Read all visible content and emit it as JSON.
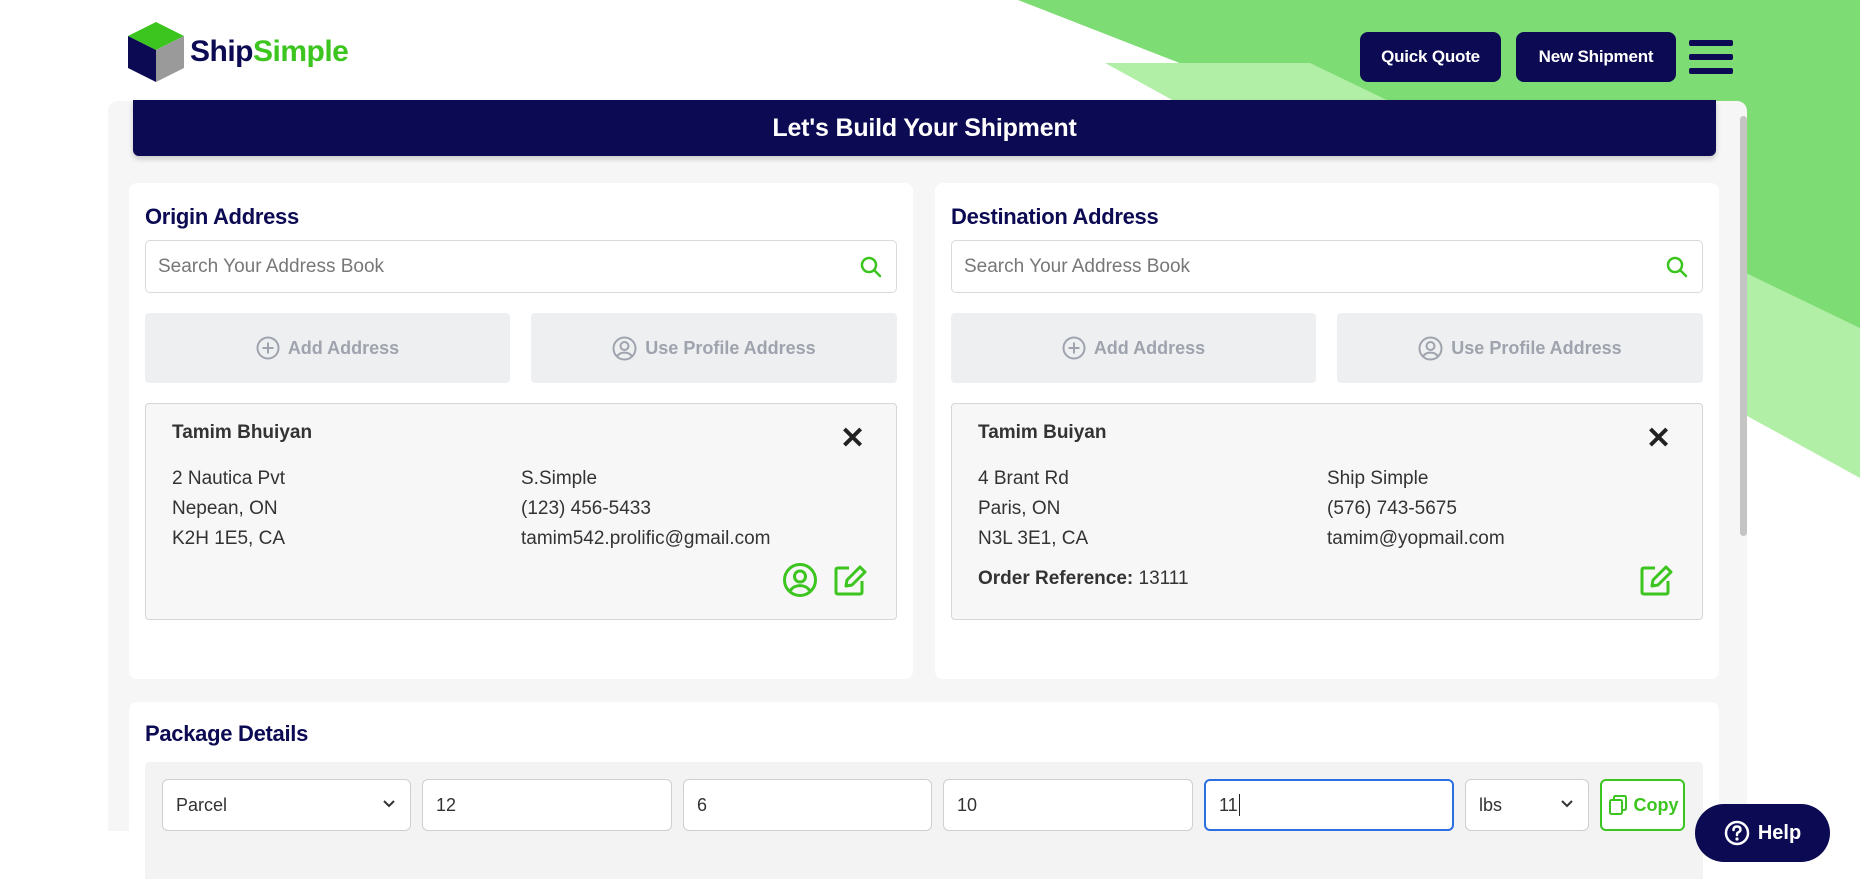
{
  "brand": {
    "name_part1": "Ship",
    "name_part2": "Simple"
  },
  "header": {
    "quick_quote": "Quick Quote",
    "new_shipment": "New Shipment"
  },
  "banner": {
    "title": "Let's Build Your Shipment"
  },
  "origin": {
    "title": "Origin Address",
    "search_placeholder": "Search Your Address Book",
    "add_address": "Add Address",
    "use_profile": "Use Profile Address",
    "name": "Tamim Bhuiyan",
    "street": "2 Nautica Pvt",
    "city": "Nepean, ON",
    "postal": "K2H 1E5, CA",
    "company": "S.Simple",
    "phone": "(123) 456-5433",
    "email": "tamim542.prolific@gmail.com"
  },
  "destination": {
    "title": "Destination Address",
    "search_placeholder": "Search Your Address Book",
    "add_address": "Add Address",
    "use_profile": "Use Profile Address",
    "name": "Tamim Buiyan",
    "street": "4 Brant Rd",
    "city": "Paris, ON",
    "postal": "N3L 3E1, CA",
    "company": "Ship Simple",
    "phone": "(576) 743-5675",
    "email": "tamim@yopmail.com",
    "order_ref_label": "Order Reference:",
    "order_ref_value": "13111"
  },
  "package": {
    "title": "Package Details",
    "type": "Parcel",
    "length": "12",
    "width": "6",
    "height": "10",
    "weight": "11",
    "unit": "lbs",
    "copy": "Copy"
  },
  "help": {
    "label": "Help"
  },
  "colors": {
    "navy": "#0c0a52",
    "green": "#3cc41f",
    "light_green": "#b2efa6",
    "mid_green": "#7ddc74"
  }
}
